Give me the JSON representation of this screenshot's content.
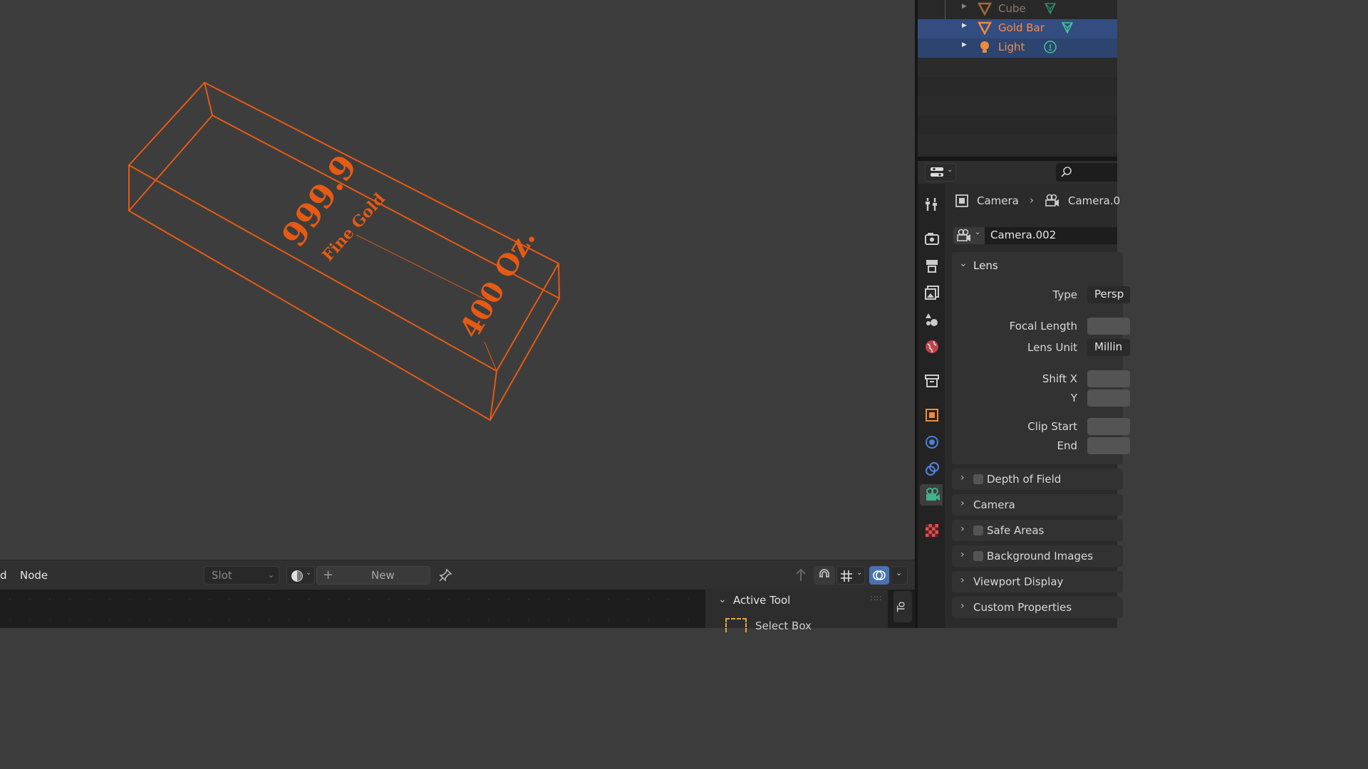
{
  "outliner": {
    "items": [
      {
        "label": "Cube",
        "color": "#8a6c55"
      },
      {
        "label": "Gold Bar",
        "color": "#f07a3a"
      },
      {
        "label": "Light",
        "color": "#f07a3a"
      }
    ]
  },
  "viewport": {
    "engraving_top": "999.9",
    "engraving_sub": "Fine Gold",
    "engraving_side": "400 Oz.",
    "wire_color": "#e65a14"
  },
  "node_header": {
    "menu_partial": "d",
    "menu_node": "Node",
    "slot_label": "Slot",
    "new_label": "New"
  },
  "npanel": {
    "active_tool_label": "Active Tool",
    "tool_name": "Select Box",
    "tab_label": "To"
  },
  "properties": {
    "breadcrumb_object": "Camera",
    "breadcrumb_data": "Camera.0",
    "datablock_name": "Camera.002",
    "lens": {
      "header": "Lens",
      "type_label": "Type",
      "type_value": "Persp",
      "focal_label": "Focal Length",
      "lens_unit_label": "Lens Unit",
      "lens_unit_value": "Millin",
      "shift_x_label": "Shift X",
      "shift_y_label": "Y",
      "clip_start_label": "Clip Start",
      "clip_end_label": "End"
    },
    "subpanels": [
      {
        "label": "Depth of Field",
        "checkbox": true
      },
      {
        "label": "Camera",
        "checkbox": false
      },
      {
        "label": "Safe Areas",
        "checkbox": true
      },
      {
        "label": "Background Images",
        "checkbox": true
      },
      {
        "label": "Viewport Display",
        "checkbox": false
      },
      {
        "label": "Custom Properties",
        "checkbox": false
      }
    ]
  },
  "colors": {
    "accent_blue": "#4772b3",
    "selection_orange": "#f07a3a",
    "camera_tab_green": "#43b08f"
  }
}
